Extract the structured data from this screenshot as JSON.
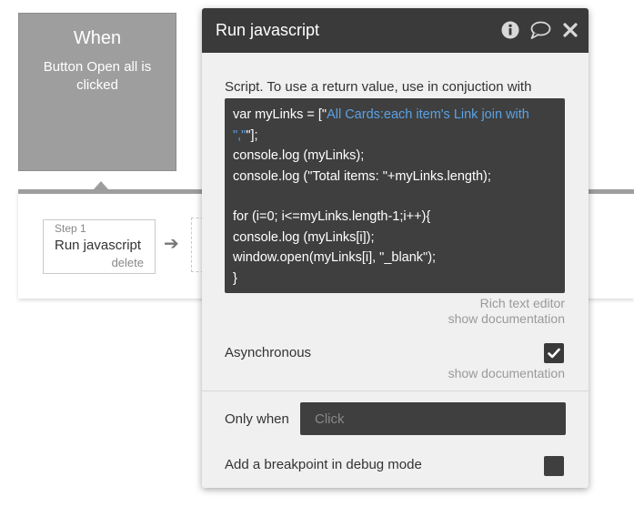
{
  "event": {
    "title": "When",
    "description": "Button Open all is clicked"
  },
  "workflow": {
    "step_number": "Step 1",
    "step_name": "Run javascript",
    "delete_label": "delete"
  },
  "popup": {
    "title": "Run javascript",
    "icons": [
      "info-icon",
      "comment-icon",
      "close-icon"
    ],
    "script_label": "Script. To use a return value, use in conjuction with",
    "code": {
      "line1_prefix": "var myLinks = [\"",
      "line1_expr": "All Cards:each item's Link join with \",\"",
      "line1_suffix": "\"];",
      "line2": "console.log (myLinks);",
      "line3": "console.log (\"Total items: \"+myLinks.length);",
      "line4": "",
      "line5": "for (i=0; i<=myLinks.length-1;i++){",
      "line6": "console.log (myLinks[i]);",
      "line7": "window.open(myLinks[i], \"_blank\");",
      "line8": "}"
    },
    "rich_text_editor": "Rich text editor",
    "show_documentation_1": "show documentation",
    "asynchronous_label": "Asynchronous",
    "asynchronous_checked": true,
    "show_documentation_2": "show documentation",
    "only_when_label": "Only when",
    "only_when_placeholder": "Click",
    "breakpoint_label": "Add a breakpoint in debug mode",
    "breakpoint_checked": false
  },
  "colors": {
    "header_bg": "#3a3a3a",
    "panel_bg": "#f0f0f0",
    "code_bg": "#3f3f3f",
    "dynamic_expression": "#5aa2e6",
    "event_block": "#9e9e9e"
  }
}
